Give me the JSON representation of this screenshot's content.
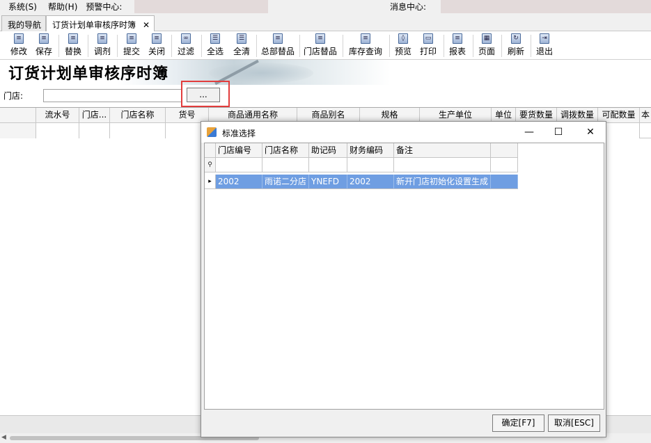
{
  "menu": {
    "system": "系统(S)",
    "help": "帮助(H)",
    "alert": "预警中心:",
    "message": "消息中心:"
  },
  "tabs": [
    {
      "label": "我的导航"
    },
    {
      "label": "订货计划单审核序时簿"
    }
  ],
  "toolbar": {
    "buttons": [
      {
        "label": "修改",
        "icon": "edit-icon"
      },
      {
        "label": "保存",
        "icon": "save-icon"
      },
      {
        "label": "替换",
        "icon": "replace-icon"
      },
      {
        "label": "调剂",
        "icon": "adjust-icon"
      },
      {
        "label": "提交",
        "icon": "submit-icon"
      },
      {
        "label": "关闭",
        "icon": "close-doc-icon"
      },
      {
        "label": "过滤",
        "icon": "binoculars-icon"
      },
      {
        "label": "全选",
        "icon": "select-all-icon"
      },
      {
        "label": "全清",
        "icon": "clear-all-icon"
      },
      {
        "label": "总部替品",
        "icon": "hq-substitute-icon"
      },
      {
        "label": "门店替品",
        "icon": "store-substitute-icon"
      },
      {
        "label": "库存查询",
        "icon": "stock-query-icon"
      },
      {
        "label": "预览",
        "icon": "preview-icon"
      },
      {
        "label": "打印",
        "icon": "printer-icon"
      },
      {
        "label": "报表",
        "icon": "report-icon"
      },
      {
        "label": "页面",
        "icon": "page-icon"
      },
      {
        "label": "刷新",
        "icon": "refresh-icon"
      },
      {
        "label": "退出",
        "icon": "exit-icon"
      }
    ]
  },
  "banner": {
    "title": "订货计划单审核序时簿"
  },
  "filter": {
    "store_label": "门店:",
    "store_value": "",
    "browse_label": "..."
  },
  "grid": {
    "columns": [
      "",
      "流水号",
      "门店...",
      "门店名称",
      "货号",
      "商品通用名称",
      "商品别名",
      "规格",
      "生产单位",
      "单位",
      "要货数量",
      "调拨数量",
      "可配数量",
      "本"
    ]
  },
  "dialog": {
    "title": "标准选择",
    "columns": [
      "门店编号",
      "门店名称",
      "助记码",
      "财务编码",
      "备注"
    ],
    "rows": [
      [
        "2002",
        "雨诺二分店",
        "YNEFD",
        "2002",
        "新开门店初始化设置生成"
      ]
    ],
    "ok_label": "确定[F7]",
    "cancel_label": "取消[ESC]"
  }
}
